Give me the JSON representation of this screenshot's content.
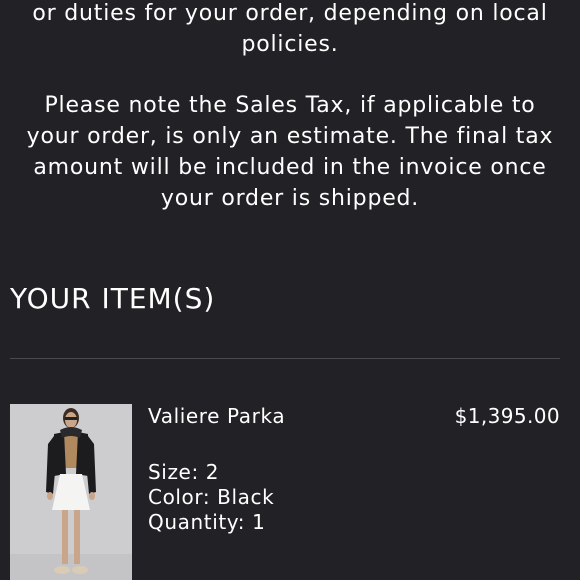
{
  "notices": {
    "duties_lines": [
      "or duties for your order, depending on local",
      "policies."
    ],
    "tax_lines": [
      "Please note the Sales Tax, if applicable to",
      "your order, is only an estimate. The final tax",
      "amount will be included in the invoice once",
      "your order is shipped."
    ]
  },
  "items_section": {
    "title": "YOUR ITEM(S)"
  },
  "items": [
    {
      "name": "Valiere Parka",
      "price": "$1,395.00",
      "size": "Size: 2",
      "color": "Color: Black",
      "quantity": "Quantity: 1",
      "thumbnail_icon": "product-photo"
    }
  ],
  "colors": {
    "background": "#222226",
    "text": "#ffffff",
    "divider": "#4a4a4f"
  }
}
